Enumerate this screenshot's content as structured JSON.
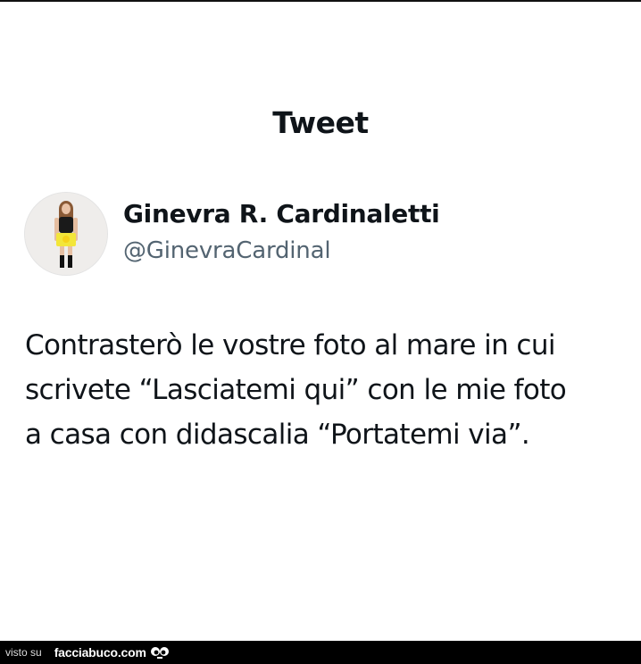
{
  "header": {
    "title": "Tweet"
  },
  "author": {
    "display_name": "Ginevra R. Cardinaletti",
    "handle": "@GinevraCardinal",
    "avatar_icon": "profile-photo"
  },
  "tweet": {
    "lines": [
      "Contrasterò le vostre foto al mare in cui",
      "scrivete “Lasciatemi qui” con le mie foto",
      "a casa con didascalia “Portatemi via”."
    ]
  },
  "footer": {
    "visto_su": "visto su",
    "site": "facciabuco.com",
    "logo_icon": "eyes-icon",
    "background": "#000000"
  },
  "colors": {
    "text_primary": "#0f1419",
    "text_secondary": "#536471",
    "background": "#ffffff"
  }
}
